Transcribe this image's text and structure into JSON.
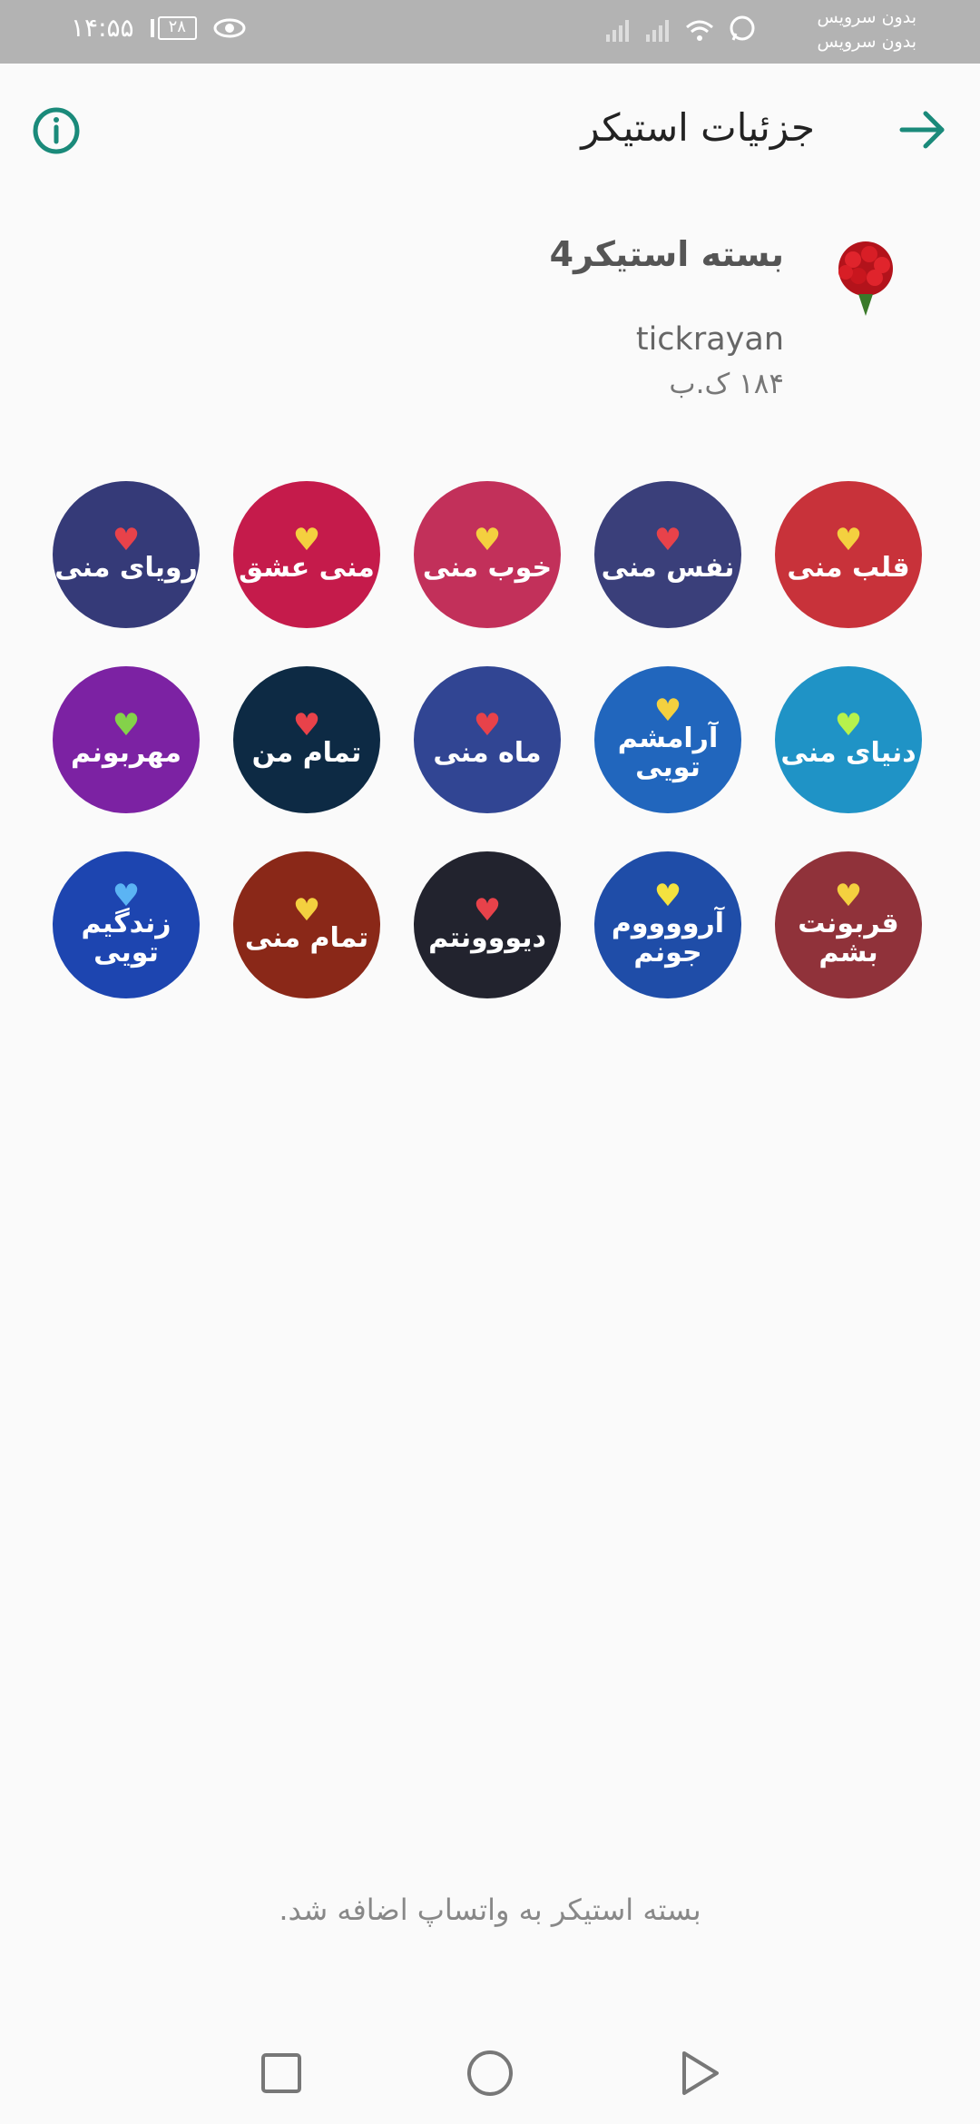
{
  "status_bar": {
    "time": "۱۴:۵۵",
    "battery": "۲۸",
    "carrier_line1": "بدون سرویس",
    "carrier_line2": "بدون سرویس"
  },
  "app_bar": {
    "title": "جزئیات استیکر",
    "back_icon": "arrow-right-icon",
    "info_icon": "info-icon"
  },
  "pack": {
    "name": "بسته استیکر4",
    "author": "tickrayan",
    "size": "۱۸۴ ک.ب"
  },
  "stickers": [
    {
      "text": "قلب منی",
      "color": "#c8323a",
      "heart": "#f4d03f"
    },
    {
      "text": "نفس منی",
      "color": "#3a3f7a",
      "heart": "#e8424a"
    },
    {
      "text": "خوب منی",
      "color": "#c2305a",
      "heart": "#f4d03f"
    },
    {
      "text": "منی عشق",
      "color": "#c51b4b",
      "heart": "#f4d03f"
    },
    {
      "text": "رویای منی",
      "color": "#353a78",
      "heart": "#e8424a"
    },
    {
      "text": "دنیای منی",
      "color": "#1f93c6",
      "heart": "#b6f24c"
    },
    {
      "text": "آرامشم تویی",
      "color": "#2166bd",
      "heart": "#f4d03f"
    },
    {
      "text": "ماه منی",
      "color": "#314593",
      "heart": "#e8424a"
    },
    {
      "text": "تمام من",
      "color": "#0d2a44",
      "heart": "#e8424a"
    },
    {
      "text": "مهربونم",
      "color": "#7c22a3",
      "heart": "#84d24a"
    },
    {
      "text": "قربونت بشم",
      "color": "#90323a",
      "heart": "#f4d03f"
    },
    {
      "text": "آرووووم جونم",
      "color": "#1f4da8",
      "heart": "#f4e23f"
    },
    {
      "text": "دیووونتم",
      "color": "#22232e",
      "heart": "#e8424a"
    },
    {
      "text": "تمام منی",
      "color": "#8a2818",
      "heart": "#f4d03f"
    },
    {
      "text": "زندگیم تویی",
      "color": "#1d45b0",
      "heart": "#5bb4f4"
    }
  ],
  "footer": {
    "added_message": "بسته استیکر به واتساپ اضافه شد."
  },
  "colors": {
    "accent": "#1a8a7a"
  }
}
